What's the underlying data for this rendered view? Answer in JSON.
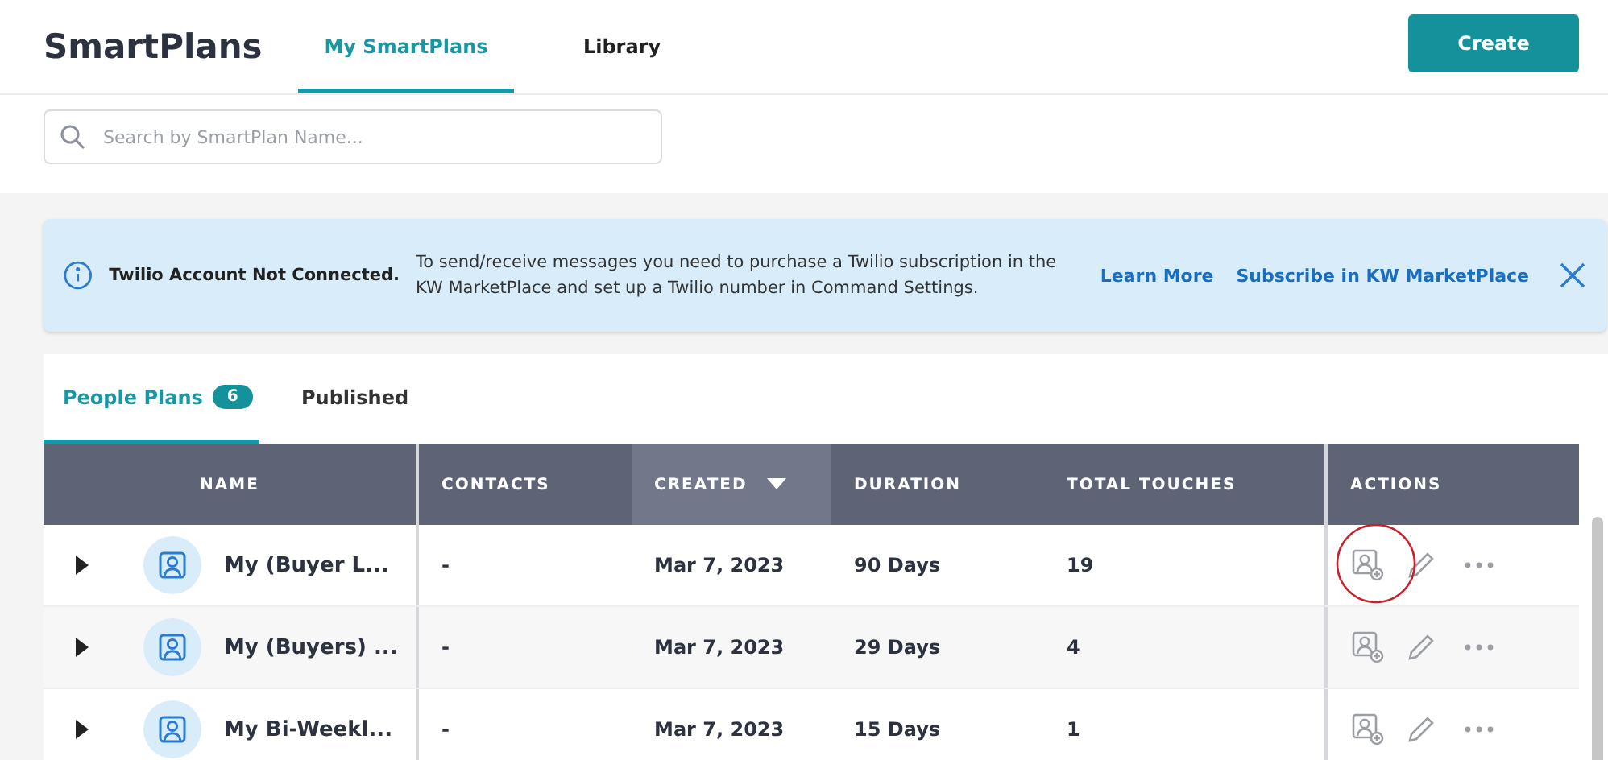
{
  "header": {
    "title": "SmartPlans",
    "tabs": [
      {
        "label": "My SmartPlans",
        "selected": true
      },
      {
        "label": "Library",
        "selected": false
      }
    ],
    "create_button": "Create"
  },
  "search": {
    "placeholder": "Search by SmartPlan Name..."
  },
  "banner": {
    "title": "Twilio Account Not Connected.",
    "message": "To send/receive messages you need to purchase a Twilio subscription in the KW MarketPlace and set up a Twilio number in Command Settings.",
    "links": [
      "Learn More",
      "Subscribe in KW MarketPlace"
    ]
  },
  "plan_tabs": [
    {
      "label": "People Plans",
      "count": "6",
      "selected": true
    },
    {
      "label": "Published",
      "selected": false
    }
  ],
  "table": {
    "columns": [
      {
        "label": "NAME",
        "sorted": false
      },
      {
        "label": "CONTACTS",
        "sorted": false
      },
      {
        "label": "CREATED",
        "sorted": true
      },
      {
        "label": "DURATION",
        "sorted": false
      },
      {
        "label": "TOTAL TOUCHES",
        "sorted": false
      },
      {
        "label": "ACTIONS",
        "sorted": false
      }
    ],
    "rows": [
      {
        "name": "My (Buyer L...",
        "contacts": "-",
        "created": "Mar 7, 2023",
        "duration": "90 Days",
        "touches": "19",
        "circled": true
      },
      {
        "name": "My (Buyers) ...",
        "contacts": "-",
        "created": "Mar 7, 2023",
        "duration": "29 Days",
        "touches": "4",
        "circled": false
      },
      {
        "name": "My Bi-Weekl...",
        "contacts": "-",
        "created": "Mar 7, 2023",
        "duration": "15 Days",
        "touches": "1",
        "circled": false
      }
    ]
  }
}
